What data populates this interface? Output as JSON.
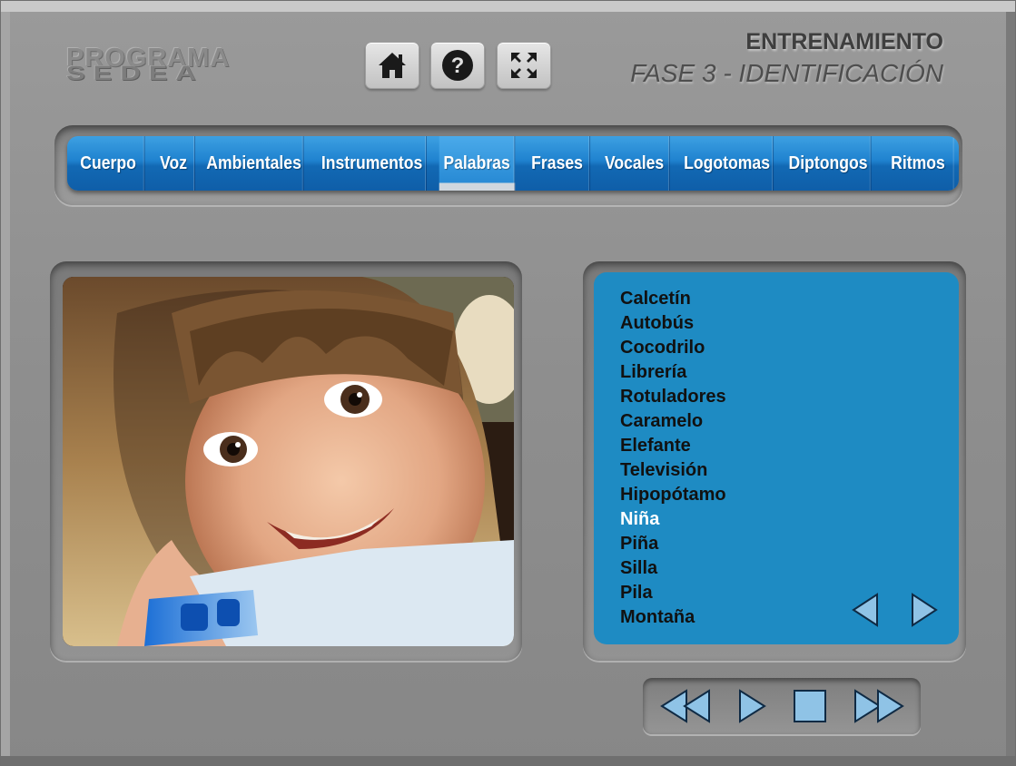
{
  "header": {
    "brand_line1": "PROGRAMA",
    "brand_line2": "SEDEA",
    "title": "ENTRENAMIENTO",
    "subtitle": "FASE 3 - IDENTIFICACIÓN",
    "toolbar": [
      {
        "icon": "home-icon"
      },
      {
        "icon": "help-icon"
      },
      {
        "icon": "fullscreen-icon"
      }
    ]
  },
  "nav": {
    "tabs": [
      {
        "label": "Cuerpo",
        "active": false
      },
      {
        "label": "Voz",
        "active": false
      },
      {
        "label": "Ambientales",
        "active": false
      },
      {
        "label": "Instrumentos",
        "active": false
      },
      {
        "label": "Palabras",
        "active": true
      },
      {
        "label": "Frases",
        "active": false
      },
      {
        "label": "Vocales",
        "active": false
      },
      {
        "label": "Logotomas",
        "active": false
      },
      {
        "label": "Diptongos",
        "active": false
      },
      {
        "label": "Ritmos",
        "active": false
      }
    ]
  },
  "words": {
    "items": [
      "Calcetín",
      "Autobús",
      "Cocodrilo",
      "Librería",
      "Rotuladores",
      "Caramelo",
      "Elefante",
      "Televisión",
      "Hipopótamo",
      "Niña",
      "Piña",
      "Silla",
      "Pila",
      "Montaña"
    ],
    "selected": "Niña",
    "prev_icon": "triangle-left-icon",
    "next_icon": "triangle-right-icon"
  },
  "player": {
    "controls": [
      "rewind-icon",
      "play-icon",
      "stop-icon",
      "fast-forward-icon"
    ]
  },
  "colors": {
    "nav_blue": "#1f82cf",
    "panel_blue": "#1e8bc3",
    "control_fill": "#8fc3e6",
    "frame_gray": "#909090",
    "selected_word": "#ffffff"
  }
}
